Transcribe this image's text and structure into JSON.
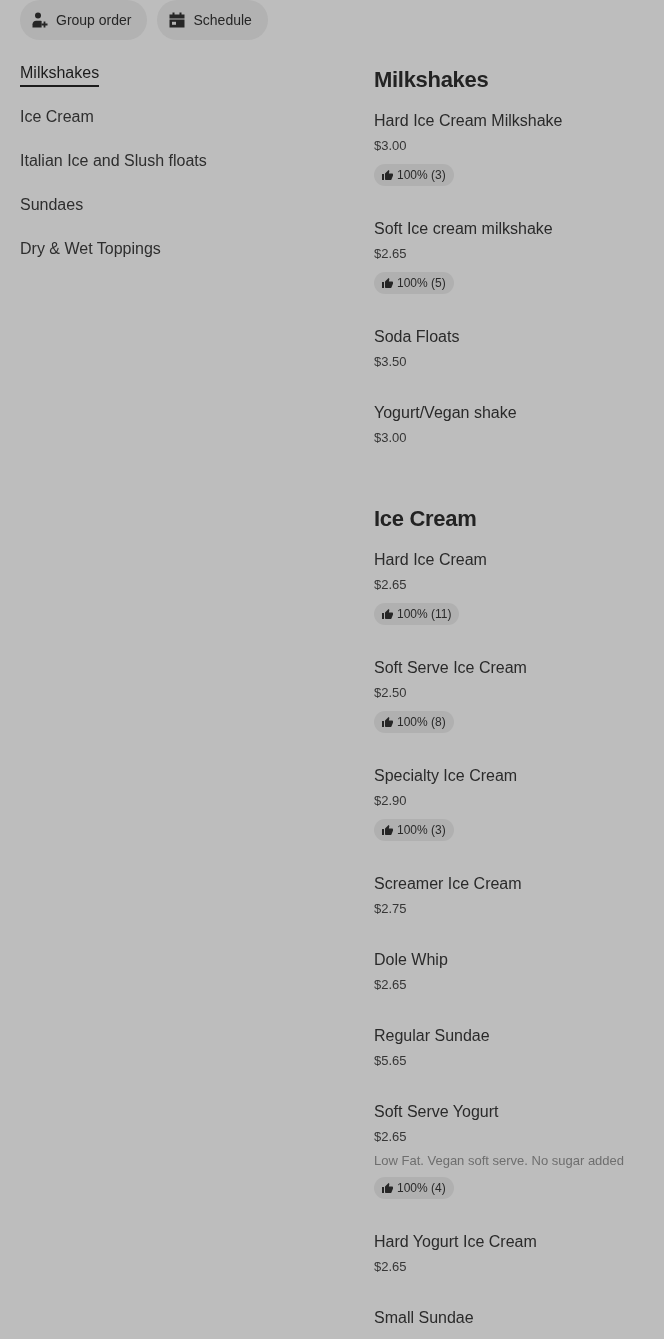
{
  "toolbar": {
    "buttons": [
      {
        "kind": "group",
        "label": "Group order"
      },
      {
        "kind": "schedule",
        "label": "Schedule"
      }
    ]
  },
  "category_nav": {
    "items": [
      {
        "label": "Milkshakes",
        "selected": true
      },
      {
        "label": "Ice Cream",
        "selected": false
      },
      {
        "label": "Italian Ice and Slush floats",
        "selected": false
      },
      {
        "label": "Sundaes",
        "selected": false
      },
      {
        "label": "Dry & Wet Toppings",
        "selected": false
      }
    ]
  },
  "sections": [
    {
      "title": "Milkshakes",
      "items": [
        {
          "name": "Hard Ice Cream Milkshake",
          "price": "$3.00",
          "rating": "100% (3)"
        },
        {
          "name": "Soft Ice cream milkshake",
          "price": "$2.65",
          "rating": "100% (5)"
        },
        {
          "name": "Soda Floats",
          "price": "$3.50"
        },
        {
          "name": "Yogurt/Vegan shake",
          "price": "$3.00"
        }
      ]
    },
    {
      "title": "Ice Cream",
      "items": [
        {
          "name": "Hard Ice Cream",
          "price": "$2.65",
          "rating": "100% (11)"
        },
        {
          "name": "Soft Serve Ice Cream",
          "price": "$2.50",
          "rating": "100% (8)"
        },
        {
          "name": "Specialty Ice Cream",
          "price": "$2.90",
          "rating": "100% (3)"
        },
        {
          "name": "Screamer Ice Cream",
          "price": "$2.75"
        },
        {
          "name": "Dole Whip",
          "price": "$2.65"
        },
        {
          "name": "Regular Sundae",
          "price": "$5.65"
        },
        {
          "name": "Soft Serve Yogurt",
          "price": "$2.65",
          "description": "Low Fat. Vegan soft serve. No sugar added",
          "rating": "100% (4)"
        },
        {
          "name": "Hard Yogurt Ice Cream",
          "price": "$2.65"
        },
        {
          "name": "Small Sundae"
        }
      ]
    }
  ]
}
